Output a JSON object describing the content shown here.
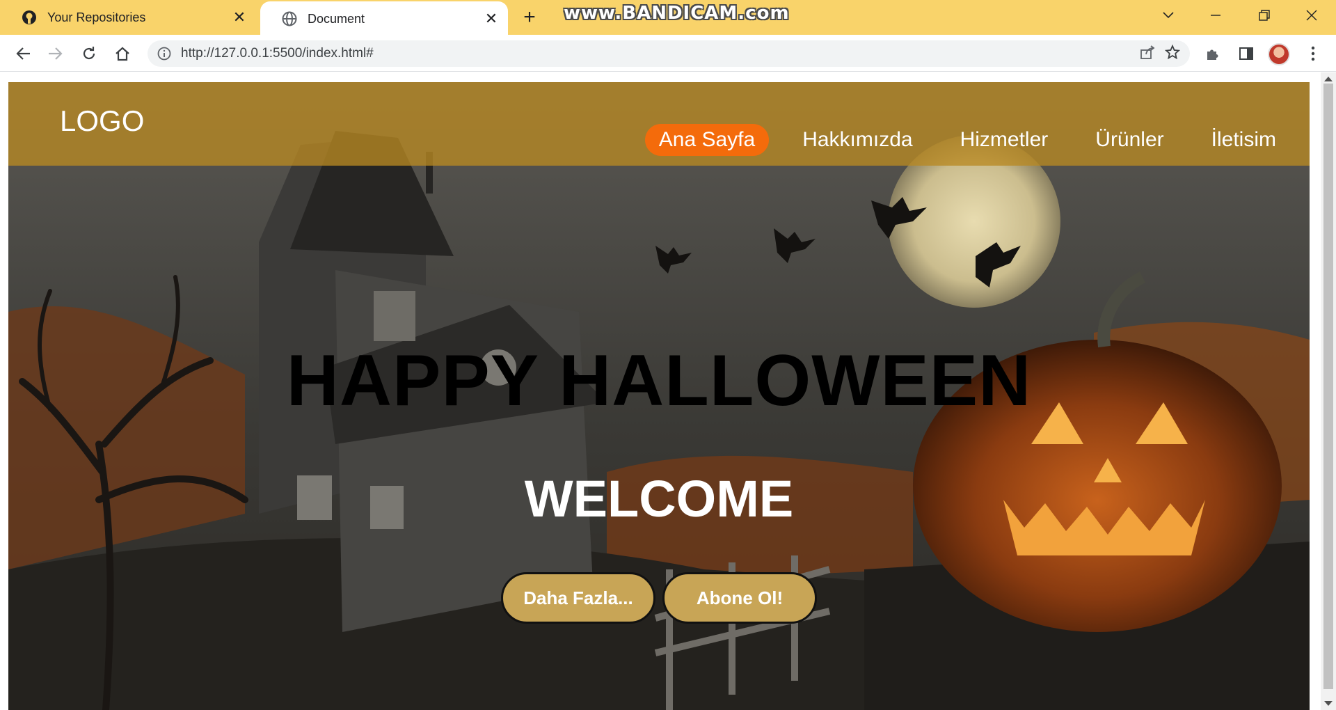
{
  "browser": {
    "tabs": [
      {
        "title": "Your Repositories",
        "icon": "github-icon",
        "active": false
      },
      {
        "title": "Document",
        "icon": "globe-icon",
        "active": true
      }
    ],
    "watermark": "www.BANDICAM.com",
    "url": "http://127.0.0.1:5500/index.html#"
  },
  "site": {
    "logo": "LOGO",
    "nav": [
      {
        "label": "Ana Sayfa",
        "active": true
      },
      {
        "label": "Hakkımızda",
        "active": false
      },
      {
        "label": "Hizmetler",
        "active": false
      },
      {
        "label": "Ürünler",
        "active": false
      },
      {
        "label": "İletisim",
        "active": false
      }
    ],
    "hero": {
      "title": "HAPPY HALLOWEEN",
      "subtitle": "WELCOME",
      "buttons": [
        "Daha Fazla...",
        "Abone Ol!"
      ]
    }
  },
  "colors": {
    "tabstrip": "#f9d36a",
    "header_overlay": "#b88923",
    "nav_active": "#f46b0b",
    "hero_button": "#c8a556"
  }
}
